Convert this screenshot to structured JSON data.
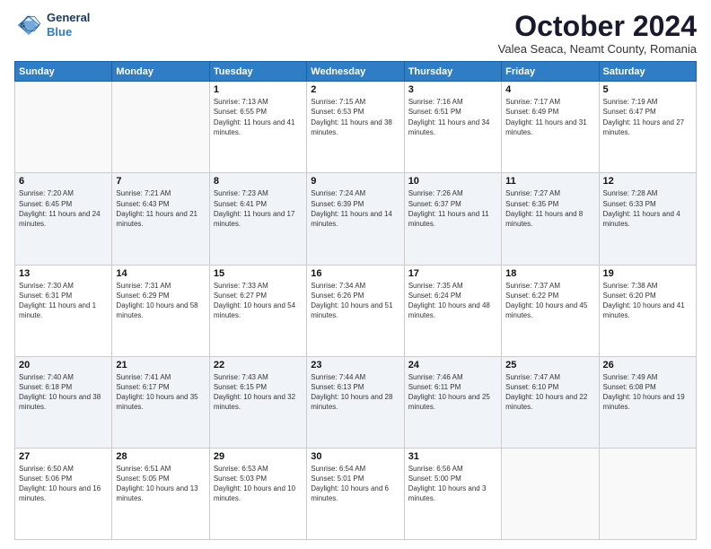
{
  "header": {
    "logo_line1": "General",
    "logo_line2": "Blue",
    "month_title": "October 2024",
    "subtitle": "Valea Seaca, Neamt County, Romania"
  },
  "days_of_week": [
    "Sunday",
    "Monday",
    "Tuesday",
    "Wednesday",
    "Thursday",
    "Friday",
    "Saturday"
  ],
  "weeks": [
    [
      {
        "day": "",
        "info": ""
      },
      {
        "day": "",
        "info": ""
      },
      {
        "day": "1",
        "info": "Sunrise: 7:13 AM\nSunset: 6:55 PM\nDaylight: 11 hours and 41 minutes."
      },
      {
        "day": "2",
        "info": "Sunrise: 7:15 AM\nSunset: 6:53 PM\nDaylight: 11 hours and 38 minutes."
      },
      {
        "day": "3",
        "info": "Sunrise: 7:16 AM\nSunset: 6:51 PM\nDaylight: 11 hours and 34 minutes."
      },
      {
        "day": "4",
        "info": "Sunrise: 7:17 AM\nSunset: 6:49 PM\nDaylight: 11 hours and 31 minutes."
      },
      {
        "day": "5",
        "info": "Sunrise: 7:19 AM\nSunset: 6:47 PM\nDaylight: 11 hours and 27 minutes."
      }
    ],
    [
      {
        "day": "6",
        "info": "Sunrise: 7:20 AM\nSunset: 6:45 PM\nDaylight: 11 hours and 24 minutes."
      },
      {
        "day": "7",
        "info": "Sunrise: 7:21 AM\nSunset: 6:43 PM\nDaylight: 11 hours and 21 minutes."
      },
      {
        "day": "8",
        "info": "Sunrise: 7:23 AM\nSunset: 6:41 PM\nDaylight: 11 hours and 17 minutes."
      },
      {
        "day": "9",
        "info": "Sunrise: 7:24 AM\nSunset: 6:39 PM\nDaylight: 11 hours and 14 minutes."
      },
      {
        "day": "10",
        "info": "Sunrise: 7:26 AM\nSunset: 6:37 PM\nDaylight: 11 hours and 11 minutes."
      },
      {
        "day": "11",
        "info": "Sunrise: 7:27 AM\nSunset: 6:35 PM\nDaylight: 11 hours and 8 minutes."
      },
      {
        "day": "12",
        "info": "Sunrise: 7:28 AM\nSunset: 6:33 PM\nDaylight: 11 hours and 4 minutes."
      }
    ],
    [
      {
        "day": "13",
        "info": "Sunrise: 7:30 AM\nSunset: 6:31 PM\nDaylight: 11 hours and 1 minute."
      },
      {
        "day": "14",
        "info": "Sunrise: 7:31 AM\nSunset: 6:29 PM\nDaylight: 10 hours and 58 minutes."
      },
      {
        "day": "15",
        "info": "Sunrise: 7:33 AM\nSunset: 6:27 PM\nDaylight: 10 hours and 54 minutes."
      },
      {
        "day": "16",
        "info": "Sunrise: 7:34 AM\nSunset: 6:26 PM\nDaylight: 10 hours and 51 minutes."
      },
      {
        "day": "17",
        "info": "Sunrise: 7:35 AM\nSunset: 6:24 PM\nDaylight: 10 hours and 48 minutes."
      },
      {
        "day": "18",
        "info": "Sunrise: 7:37 AM\nSunset: 6:22 PM\nDaylight: 10 hours and 45 minutes."
      },
      {
        "day": "19",
        "info": "Sunrise: 7:38 AM\nSunset: 6:20 PM\nDaylight: 10 hours and 41 minutes."
      }
    ],
    [
      {
        "day": "20",
        "info": "Sunrise: 7:40 AM\nSunset: 6:18 PM\nDaylight: 10 hours and 38 minutes."
      },
      {
        "day": "21",
        "info": "Sunrise: 7:41 AM\nSunset: 6:17 PM\nDaylight: 10 hours and 35 minutes."
      },
      {
        "day": "22",
        "info": "Sunrise: 7:43 AM\nSunset: 6:15 PM\nDaylight: 10 hours and 32 minutes."
      },
      {
        "day": "23",
        "info": "Sunrise: 7:44 AM\nSunset: 6:13 PM\nDaylight: 10 hours and 28 minutes."
      },
      {
        "day": "24",
        "info": "Sunrise: 7:46 AM\nSunset: 6:11 PM\nDaylight: 10 hours and 25 minutes."
      },
      {
        "day": "25",
        "info": "Sunrise: 7:47 AM\nSunset: 6:10 PM\nDaylight: 10 hours and 22 minutes."
      },
      {
        "day": "26",
        "info": "Sunrise: 7:49 AM\nSunset: 6:08 PM\nDaylight: 10 hours and 19 minutes."
      }
    ],
    [
      {
        "day": "27",
        "info": "Sunrise: 6:50 AM\nSunset: 5:06 PM\nDaylight: 10 hours and 16 minutes."
      },
      {
        "day": "28",
        "info": "Sunrise: 6:51 AM\nSunset: 5:05 PM\nDaylight: 10 hours and 13 minutes."
      },
      {
        "day": "29",
        "info": "Sunrise: 6:53 AM\nSunset: 5:03 PM\nDaylight: 10 hours and 10 minutes."
      },
      {
        "day": "30",
        "info": "Sunrise: 6:54 AM\nSunset: 5:01 PM\nDaylight: 10 hours and 6 minutes."
      },
      {
        "day": "31",
        "info": "Sunrise: 6:56 AM\nSunset: 5:00 PM\nDaylight: 10 hours and 3 minutes."
      },
      {
        "day": "",
        "info": ""
      },
      {
        "day": "",
        "info": ""
      }
    ]
  ]
}
